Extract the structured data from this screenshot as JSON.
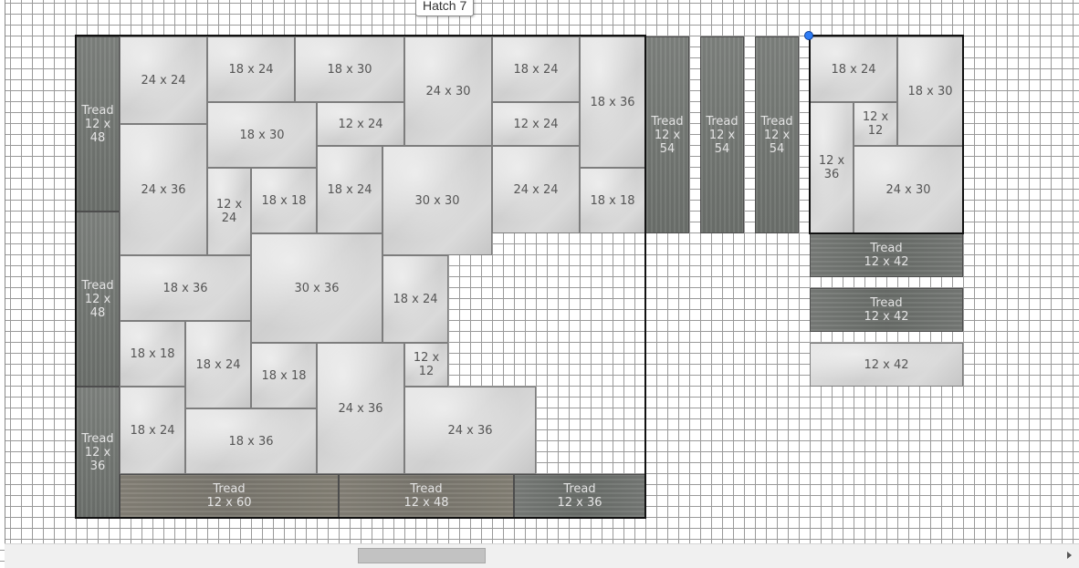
{
  "tooltip": "Hatch 7",
  "layout": {
    "tiles": [
      {
        "name": "tread-left-1",
        "kind": "tread",
        "dir": "v",
        "label": "Tread\n12 x 48"
      },
      {
        "name": "tread-left-2",
        "kind": "tread",
        "dir": "v",
        "label": "Tread\n12 x 48"
      },
      {
        "name": "tread-left-3",
        "kind": "tread",
        "dir": "v",
        "label": "Tread\n12 x 36"
      },
      {
        "name": "tile-24x24-a",
        "kind": "tile",
        "label": "24 x 24"
      },
      {
        "name": "tile-18x24-a",
        "kind": "tile",
        "label": "18 x 24"
      },
      {
        "name": "tile-18x30-a",
        "kind": "tile",
        "label": "18 x 30"
      },
      {
        "name": "tile-24x30-a",
        "kind": "tile",
        "label": "24 x 30"
      },
      {
        "name": "tile-18x24-b",
        "kind": "tile",
        "label": "18 x 24"
      },
      {
        "name": "tile-18x36-a",
        "kind": "tile",
        "label": "18 x 36"
      },
      {
        "name": "tile-18x30-b",
        "kind": "tile",
        "label": "18 x 30"
      },
      {
        "name": "tile-12x24-a",
        "kind": "tile",
        "label": "12 x 24"
      },
      {
        "name": "tile-12x24-b",
        "kind": "tile",
        "label": "12 x 24"
      },
      {
        "name": "tile-24x36-a",
        "kind": "tile",
        "label": "24 x 36"
      },
      {
        "name": "tile-12x24-c",
        "kind": "tile",
        "label": "12 x 24"
      },
      {
        "name": "tile-18x18-a",
        "kind": "tile",
        "label": "18 x 18"
      },
      {
        "name": "tile-18x24-c",
        "kind": "tile",
        "label": "18 x 24"
      },
      {
        "name": "tile-30x30-a",
        "kind": "tile",
        "label": "30 x 30"
      },
      {
        "name": "tile-24x24-b",
        "kind": "tile",
        "label": "24 x 24"
      },
      {
        "name": "tile-18x18-b",
        "kind": "tile",
        "label": "18 x 18"
      },
      {
        "name": "tile-18x36-b",
        "kind": "tile",
        "label": "18 x 36"
      },
      {
        "name": "tile-30x36-a",
        "kind": "tile",
        "label": "30 x 36"
      },
      {
        "name": "tile-18x24-d",
        "kind": "tile",
        "label": "18 x 24"
      },
      {
        "name": "tile-18x18-c",
        "kind": "tile",
        "label": "18 x 18"
      },
      {
        "name": "tile-18x24-e",
        "kind": "tile",
        "label": "18 x 24"
      },
      {
        "name": "tile-18x18-d",
        "kind": "tile",
        "label": "18 x 18"
      },
      {
        "name": "tile-24x36-b",
        "kind": "tile",
        "label": "24 x 36"
      },
      {
        "name": "tile-12x12-a",
        "kind": "tile",
        "label": "12 x 12"
      },
      {
        "name": "tile-24x36-c",
        "kind": "tile",
        "label": "24 x 36"
      },
      {
        "name": "tile-18x24-f",
        "kind": "tile",
        "label": "18 x 24"
      },
      {
        "name": "tile-18x36-c",
        "kind": "tile",
        "label": "18 x 36"
      },
      {
        "name": "tread-bottom-1",
        "kind": "tread",
        "dir": "h",
        "tone": "warm",
        "label": "Tread\n12 x 60"
      },
      {
        "name": "tread-bottom-2",
        "kind": "tread",
        "dir": "h",
        "tone": "warm",
        "label": "Tread\n12 x 48"
      },
      {
        "name": "tread-bottom-3",
        "kind": "tread",
        "dir": "h",
        "label": "Tread\n12 x 36"
      },
      {
        "name": "tread-vert-1",
        "kind": "tread",
        "dir": "v",
        "label": "Tread\n12 x 54"
      },
      {
        "name": "tread-vert-2",
        "kind": "tread",
        "dir": "v",
        "label": "Tread\n12 x 54"
      },
      {
        "name": "tread-vert-3",
        "kind": "tread",
        "dir": "v",
        "label": "Tread\n12 x 54"
      },
      {
        "name": "tile-18x24-g",
        "kind": "tile",
        "label": "18 x 24"
      },
      {
        "name": "tile-18x30-c",
        "kind": "tile",
        "label": "18 x 30"
      },
      {
        "name": "tile-12x36-a",
        "kind": "tile",
        "label": "12 x 36"
      },
      {
        "name": "tile-12x12-b",
        "kind": "tile",
        "label": "12 x 12"
      },
      {
        "name": "tile-24x30-b",
        "kind": "tile",
        "label": "24 x 30"
      },
      {
        "name": "tread-right-1",
        "kind": "tread",
        "dir": "h",
        "label": "Tread\n12 x 42"
      },
      {
        "name": "tread-right-2",
        "kind": "tread",
        "dir": "h",
        "label": "Tread\n12 x 42"
      },
      {
        "name": "tile-12x42-a",
        "kind": "tile",
        "label": "12 x 42"
      }
    ]
  }
}
